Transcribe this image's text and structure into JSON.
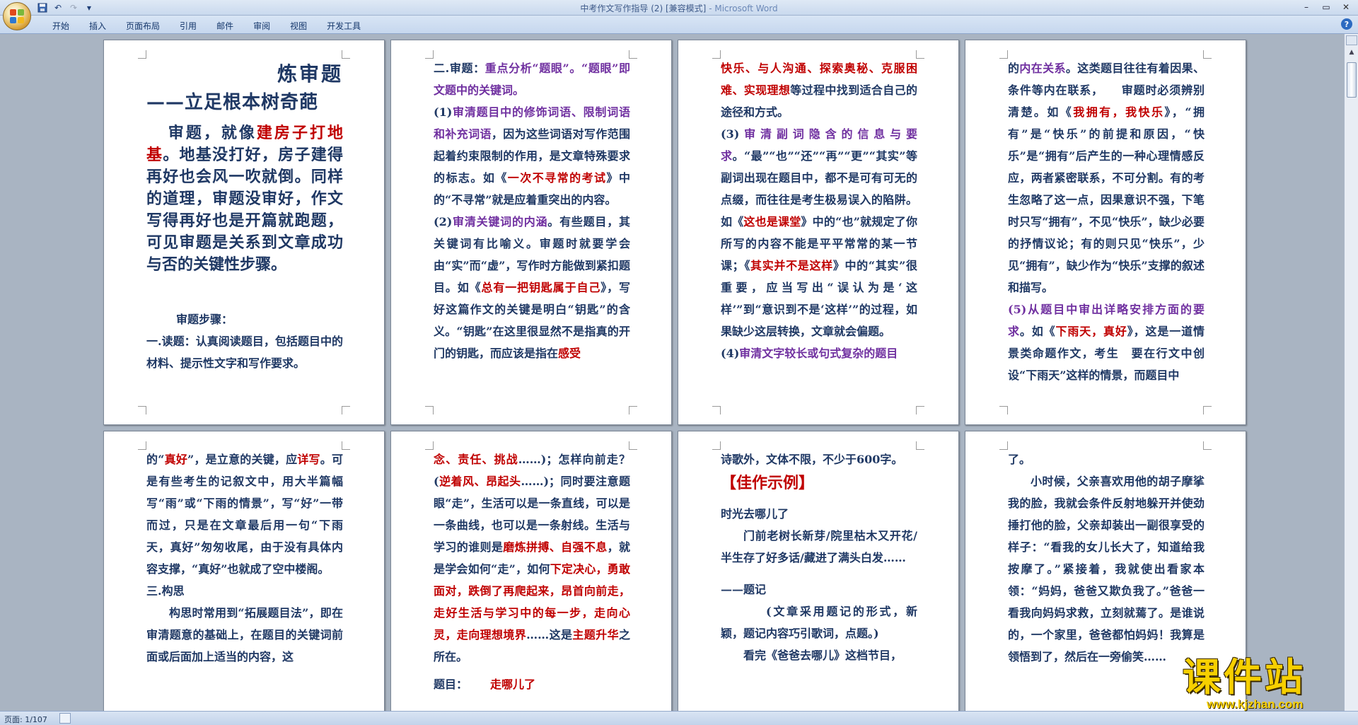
{
  "window": {
    "title": "中考作文写作指导 (2) [兼容模式]",
    "app": "Microsoft Word",
    "title_sep": " - "
  },
  "ribbon": {
    "tabs": [
      "开始",
      "插入",
      "页面布局",
      "引用",
      "邮件",
      "审阅",
      "视图",
      "开发工具"
    ]
  },
  "status": {
    "page": "页面: 1/107"
  },
  "watermark": {
    "brand": "课件站",
    "url": "www.kjzhan.com"
  },
  "pages": {
    "p1": {
      "title": "炼审题",
      "subtitle": "——立足根本树奇葩",
      "intro_a": "审题，就像",
      "intro_red": "建房子打地基",
      "intro_b": "。地基没打好，房子建得再好也会风一吹就倒。同样的道理，审题没审好，作文写得再好也是开篇就跑题，可见审题是关系到文章成功与否的关键性步骤。",
      "steps": "审题步骤：",
      "read": "一.读题：认真阅读题目，包括题目中的材料、提示性文字和写作要求。"
    },
    "p2": {
      "h2a": "二.审题：",
      "h2b": "重点分析“题眼”。“题眼”即文题中的关键词。",
      "s1a": "(1)",
      "s1b": "审清题目中的修饰词语、限制词语和补充词语",
      "s1c": "，因为这些词语对写作范围起着约束限制的作用，是文章特殊要求的标志。如《",
      "s1d": "一次不寻常的考试",
      "s1e": "》中的“不寻常”就是应着重突出的内容。",
      "s2a": "(2)",
      "s2b": "审清关键词的内涵",
      "s2c": "。有些题目，其关键词有比喻义。审题时就要学会由“实”而“虚”，写作时方能做到紧扣题目。如《",
      "s2d": "总有一把钥匙属于自己",
      "s2e": "》，写好这篇作文的关键是明白“钥匙”的含义。“钥匙”在这里很显然不是指真的开门的钥匙，而应该是指在",
      "s2f": "感受"
    },
    "p3": {
      "l1": "快乐、与人沟通、探索奥秘、克服困难、实现理想",
      "l2": "等过程中找到适合自己的途径和方式。",
      "s3a": "(3)",
      "s3b": "审清副词隐含的信息与要求",
      "s3c": "。“最”“也”“还”“再”“更”“其实”等副词出现在题目中，都不是可有可无的点缀，而往往是考生极易误入的陷阱。如《",
      "s3d": "这也是课堂",
      "s3e": "》中的“也”就规定了你所写的内容不能是平平常常的某一节课；《",
      "s3f": "其实并不是这样",
      "s3g": "》中的“其实”很重要，应当写出“误认为是‘这样’”到“意识到不是‘这样’”的过程，如果缺少这层转换，文章就会偏题。",
      "s4a": "(4)",
      "s4b": "审清文字较长或句式复杂的题目"
    },
    "p4": {
      "l1a": "的",
      "l1b": "内在关系",
      "l1c": "。这类题目往往有着因果、条件等内在联系，　　审题时必须辨别清楚。如《",
      "l1d": "我拥有，我快乐",
      "l1e": "》，“拥有”是“快乐”的前提和原因，“快乐”是“拥有”后产生的一种心理情感反应，两者紧密联系，不可分割。有的考生忽略了这一点，因果意识不强，下笔时只写“拥有”，不见“快乐”，缺少必要的抒情议论；有的则只见“快乐”，少见“拥有”，缺少作为“快乐”支撑的叙述和描写。",
      "s5a": "(5)",
      "s5b": "从题目中审出详略安排方面的要求",
      "s5c": "。如《",
      "s5d": "下雨天，真好",
      "s5e": "》，这是一道情景类命题作文，考生　要在行文中创设“下雨天”这样的情景，而题目中"
    },
    "p5": {
      "a1": "的“",
      "a2": "真好",
      "a3": "”，是立意的关键，应",
      "a4": "详写",
      "a5": "。可是有些考生的记叙文中，用大半篇幅写“雨”或“下雨的情景”，写“好”一带而过，只是在文章最后用一句“下雨天，真好”匆匆收尾，由于没有具体内容支撑，“真好”也就成了空中楼阁。",
      "h3": "三.构思",
      "b1": "构思时常用到“拓展题目法”，即在审清题意的基础上，在题目的关键词前面或后面加上适当的内容，这"
    },
    "p6": {
      "a1": "念、责任、挑战",
      "a2": "……)；怎样向前走？(",
      "a3": "逆着风、昂起头",
      "a4": "……)；同时要注意题眼“走”，生活可以是一条直线，可以是一条曲线，也可以是一条射线。生活与学习的谁则是",
      "a5": "磨炼拼搏、自强不息",
      "a6": "，就是学会如何“走”，如何",
      "a7": "下定决心，勇敢面对，跌倒了再爬起来，昂首向前走，走好生活与学习中的每一步，走向心灵，走向理想境界",
      "a8": "……这是",
      "a9": "主题升华",
      "a10": "之所在。",
      "b1": "题目：",
      "b2": "走哪儿了"
    },
    "p7": {
      "a1": "诗歌外，文体不限，不少于600字。",
      "example": "【佳作示例】",
      "essay_title": "时光去哪儿了",
      "poem": "门前老树长新芽/院里枯木又开花/半生存了好多话/藏进了满头白发……",
      "tiji": "——题记",
      "note": "(文章采用题记的形式，新颖，题记内容巧引歌词，点题。)",
      "b1": "看完《爸爸去哪儿》这档节目，"
    },
    "p8": {
      "a1": "了。",
      "b1": "小时候，父亲喜欢用他的胡子摩挲我的脸，我就会条件反射地躲开并使劲捶打他的脸，父亲却装出一副很享受的样子：“看我的女儿长大了，知道给我按摩了。”紧接着，我就使出看家本领：“妈妈，爸爸又欺负我了。”爸爸一看我向妈妈求救，立刻就蔫了。是谁说的，一个家里，爸爸都怕妈妈！我算是领悟到了，然后在一旁偷笑……"
    }
  }
}
